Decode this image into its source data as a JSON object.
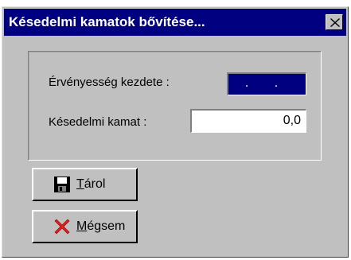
{
  "window": {
    "title": "Késedelmi kamatok bővítése..."
  },
  "form": {
    "start_label": "Érvényesség kezdete :",
    "start_value": ". .",
    "rate_label": "Késedelmi kamat :",
    "rate_value": "0,0"
  },
  "buttons": {
    "save_mnemonic": "T",
    "save_rest": "árol",
    "cancel_mnemonic": "M",
    "cancel_rest": "égsem"
  },
  "colors": {
    "titlebar": "#000080",
    "face": "#c0c0c0",
    "selection": "#000080",
    "cancel_icon": "#e0201a"
  },
  "icons": {
    "close": "close-icon",
    "save": "floppy-disk-icon",
    "cancel": "red-x-icon"
  }
}
